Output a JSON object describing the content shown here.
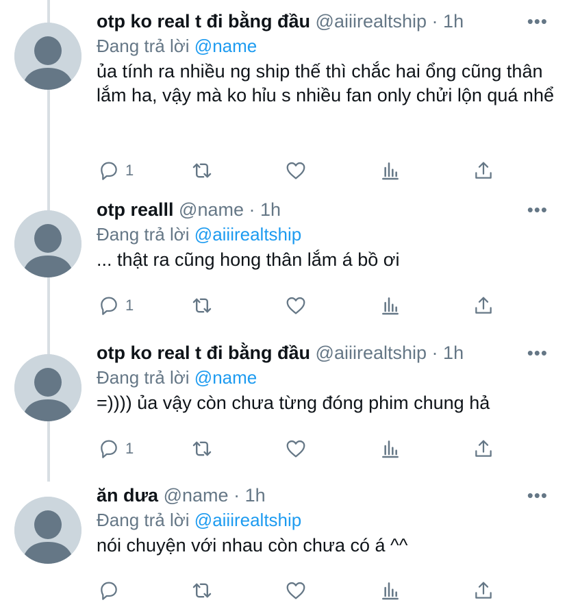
{
  "reply_prefix": "Đang trả lời",
  "more_glyph": "•••",
  "icons": {
    "reply": "reply-icon",
    "retweet": "retweet-icon",
    "like": "heart-icon",
    "views": "analytics-icon",
    "share": "share-icon"
  },
  "colors": {
    "mention": "#1d9bf0",
    "secondary": "#657786",
    "avatar_bg": "#ccd6dd",
    "avatar_figure": "#657786"
  },
  "tweets": [
    {
      "name": "otp ko real t đi bằng đầu",
      "handle": "@aiiirealtship",
      "time": "1h",
      "replying_to": "@name",
      "text": "ủa tính ra nhiều ng ship thế thì chắc hai ổng cũng thân lắm ha, vậy mà ko hỉu s nhiều fan only chửi lộn quá nhể",
      "reply_count": "1"
    },
    {
      "name": "otp realll",
      "handle": "@name",
      "time": "1h",
      "replying_to": "@aiiirealtship",
      "text": "... thật ra cũng hong thân lắm á bồ ơi",
      "reply_count": "1"
    },
    {
      "name": "otp ko real t đi bằng đầu",
      "handle": "@aiiirealtship",
      "time": "1h",
      "replying_to": "@name",
      "text": "=)))) ủa vậy còn chưa từng đóng phim chung hả",
      "reply_count": "1"
    },
    {
      "name": "ăn dưa",
      "handle": "@name",
      "time": "1h",
      "replying_to": "@aiiirealtship",
      "text": "nói chuyện với nhau còn chưa có á ^^",
      "reply_count": ""
    }
  ]
}
